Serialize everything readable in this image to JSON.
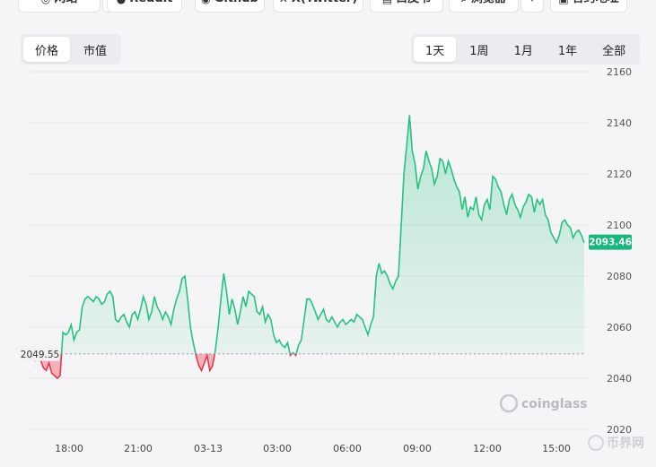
{
  "top_bar": [
    {
      "label": "网站",
      "icon": "globe-icon",
      "glyph": "◎",
      "dropdown": true
    },
    {
      "label": "Reddit",
      "icon": "reddit-icon",
      "glyph": "●",
      "dropdown": false
    },
    {
      "label": "Github",
      "icon": "github-icon",
      "glyph": "◉",
      "dropdown": false
    },
    {
      "label": "X(Twitter)",
      "icon": "x-twitter-icon",
      "glyph": "✕",
      "dropdown": false
    },
    {
      "label": "白皮书",
      "icon": "document-icon",
      "glyph": "▤",
      "dropdown": false
    },
    {
      "label": "浏览器",
      "icon": "explorer-icon",
      "glyph": "⌕",
      "dropdown": true
    },
    {
      "label": "合约地址",
      "icon": "contract-icon",
      "glyph": "▣",
      "dropdown": false
    }
  ],
  "metric_tabs": [
    {
      "label": "价格",
      "active": true
    },
    {
      "label": "市值",
      "active": false
    }
  ],
  "range_tabs": [
    {
      "label": "1天",
      "active": true
    },
    {
      "label": "1周",
      "active": false
    },
    {
      "label": "1月",
      "active": false
    },
    {
      "label": "1年",
      "active": false
    },
    {
      "label": "全部",
      "active": false
    }
  ],
  "watermarks": {
    "brand": "coinglass",
    "site": "币界网"
  },
  "colors": {
    "up": "#26c281",
    "down": "#e8384f",
    "up_fill": "#d6f4e5",
    "down_fill": "#f3a0aa",
    "badge": "#16b979"
  },
  "chart_data": {
    "type": "area",
    "ylim": [
      2020,
      2160
    ],
    "yticks": [
      "2160",
      "2140",
      "2120",
      "2100",
      "2080",
      "2060",
      "2040",
      "2020"
    ],
    "xticks": [
      "18:00",
      "21:00",
      "03-13",
      "03:00",
      "06:00",
      "09:00",
      "12:00",
      "15:00"
    ],
    "baseline": 2049.55,
    "baseline_label": "2049.55",
    "last_price": 2093.46,
    "last_price_label": "2093.46",
    "series": [
      2048,
      2049,
      2047,
      2049,
      2047,
      2044,
      2043,
      2046,
      2042,
      2041,
      2040,
      2041,
      2058,
      2057,
      2058,
      2061,
      2055,
      2058,
      2059,
      2068,
      2071,
      2072,
      2071,
      2070,
      2072,
      2071,
      2069,
      2070,
      2073,
      2074,
      2072,
      2063,
      2062,
      2064,
      2065,
      2062,
      2060,
      2065,
      2066,
      2063,
      2067,
      2072,
      2069,
      2063,
      2066,
      2072,
      2068,
      2066,
      2063,
      2066,
      2064,
      2061,
      2067,
      2071,
      2074,
      2079,
      2080,
      2071,
      2060,
      2054,
      2049,
      2045,
      2043,
      2046,
      2049,
      2043,
      2045,
      2051,
      2060,
      2071,
      2081,
      2074,
      2065,
      2071,
      2067,
      2061,
      2066,
      2072,
      2068,
      2074,
      2073,
      2072,
      2066,
      2065,
      2068,
      2062,
      2065,
      2063,
      2057,
      2054,
      2055,
      2053,
      2052,
      2054,
      2049,
      2050,
      2049,
      2053,
      2055,
      2063,
      2071,
      2071,
      2069,
      2066,
      2063,
      2065,
      2067,
      2063,
      2062,
      2064,
      2062,
      2060,
      2062,
      2063,
      2061,
      2062,
      2063,
      2062,
      2065,
      2064,
      2063,
      2060,
      2057,
      2061,
      2064,
      2080,
      2085,
      2081,
      2082,
      2080,
      2077,
      2075,
      2078,
      2080,
      2100,
      2120,
      2131,
      2143,
      2129,
      2124,
      2114,
      2119,
      2122,
      2129,
      2125,
      2122,
      2116,
      2119,
      2126,
      2125,
      2120,
      2125,
      2122,
      2118,
      2115,
      2113,
      2106,
      2111,
      2103,
      2107,
      2106,
      2111,
      2104,
      2102,
      2108,
      2110,
      2106,
      2119,
      2118,
      2115,
      2113,
      2108,
      2104,
      2110,
      2112,
      2108,
      2106,
      2103,
      2107,
      2109,
      2112,
      2111,
      2105,
      2110,
      2108,
      2110,
      2104,
      2102,
      2097,
      2095,
      2093,
      2096,
      2101,
      2102,
      2100,
      2099,
      2095,
      2097,
      2098,
      2096,
      2093
    ]
  }
}
